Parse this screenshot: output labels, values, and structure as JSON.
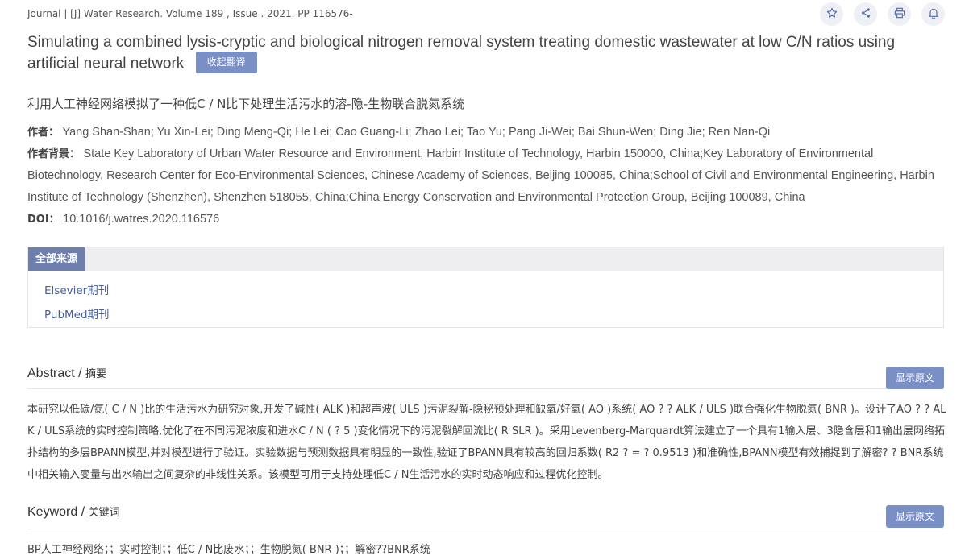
{
  "journal_line": "Journal | [J] Water Research. Volume 189 , Issue . 2021. PP 116576-",
  "icons": [
    "star-icon",
    "share-icon",
    "print-icon",
    "bell-icon"
  ],
  "title": "Simulating a combined lysis-cryptic and biological nitrogen removal system treating domestic wastewater at low C/N ratios using artificial neural network",
  "collapse_translation_label": "收起翻译",
  "title_cn": "利用人工神经网络模拟了一种低C / N比下处理生活污水的溶-隐-生物联合脱氮系统",
  "authors": {
    "label": "作者：",
    "value": "Yang Shan-Shan; Yu Xin-Lei; Ding Meng-Qi; He Lei; Cao Guang-Li; Zhao Lei; Tao Yu; Pang Ji-Wei; Bai Shun-Wen; Ding Jie; Ren Nan-Qi"
  },
  "affiliation": {
    "label": "作者背景：",
    "value": "State Key Laboratory of Urban Water Resource and Environment, Harbin Institute of Technology, Harbin 150000, China;Key Laboratory of Environmental Biotechnology, Research Center for Eco-Environmental Sciences, Chinese Academy of Sciences, Beijing 100085, China;School of Civil and Environmental Engineering, Harbin Institute of Technology (Shenzhen), Shenzhen 518055, China;China Energy Conservation and Environmental Protection Group, Beijing 100089, China"
  },
  "doi": {
    "label": "DOI：",
    "value": "10.1016/j.watres.2020.116576"
  },
  "sources": {
    "tab_label": "全部来源",
    "items": [
      "Elsevier期刊",
      "PubMed期刊"
    ]
  },
  "abstract": {
    "title": "Abstract / ",
    "title_cn": "摘要",
    "show_original": "显示原文",
    "text": "本研究以低碳/氮( C / N )比的生活污水为研究对象,开发了碱性( ALK )和超声波( ULS )污泥裂解-隐秘预处理和缺氧/好氧( AO )系统( AO ? ? ALK / ULS )联合强化生物脱氮( BNR )。设计了AO ? ? ALK / ULS系统的实时控制策略,优化了在不同污泥浓度和进水C / N ( ? 5 )变化情况下的污泥裂解回流比( R SLR )。采用Levenberg-Marquardt算法建立了一个具有1输入层、3隐含层和1输出层网络拓扑结构的多层BPANN模型,并对模型进行了验证。实验数据与预测数据具有明显的一致性,验证了BPANN具有较高的回归系数( R2 ? = ? 0.9513 )和准确性,BPANN模型有效捕捉到了解密? ? BNR系统中相关输入变量与出水输出之间复杂的非线性关系。该模型可用于支持处理低C / N生活污水的实时动态响应和过程优化控制。"
  },
  "keyword": {
    "title": "Keyword / ",
    "title_cn": "关键词",
    "show_original": "显示原文",
    "text": "BP人工神经网络；；实时控制；；低C / N比废水；；生物脱氮( BNR )；；解密??BNR系统"
  }
}
